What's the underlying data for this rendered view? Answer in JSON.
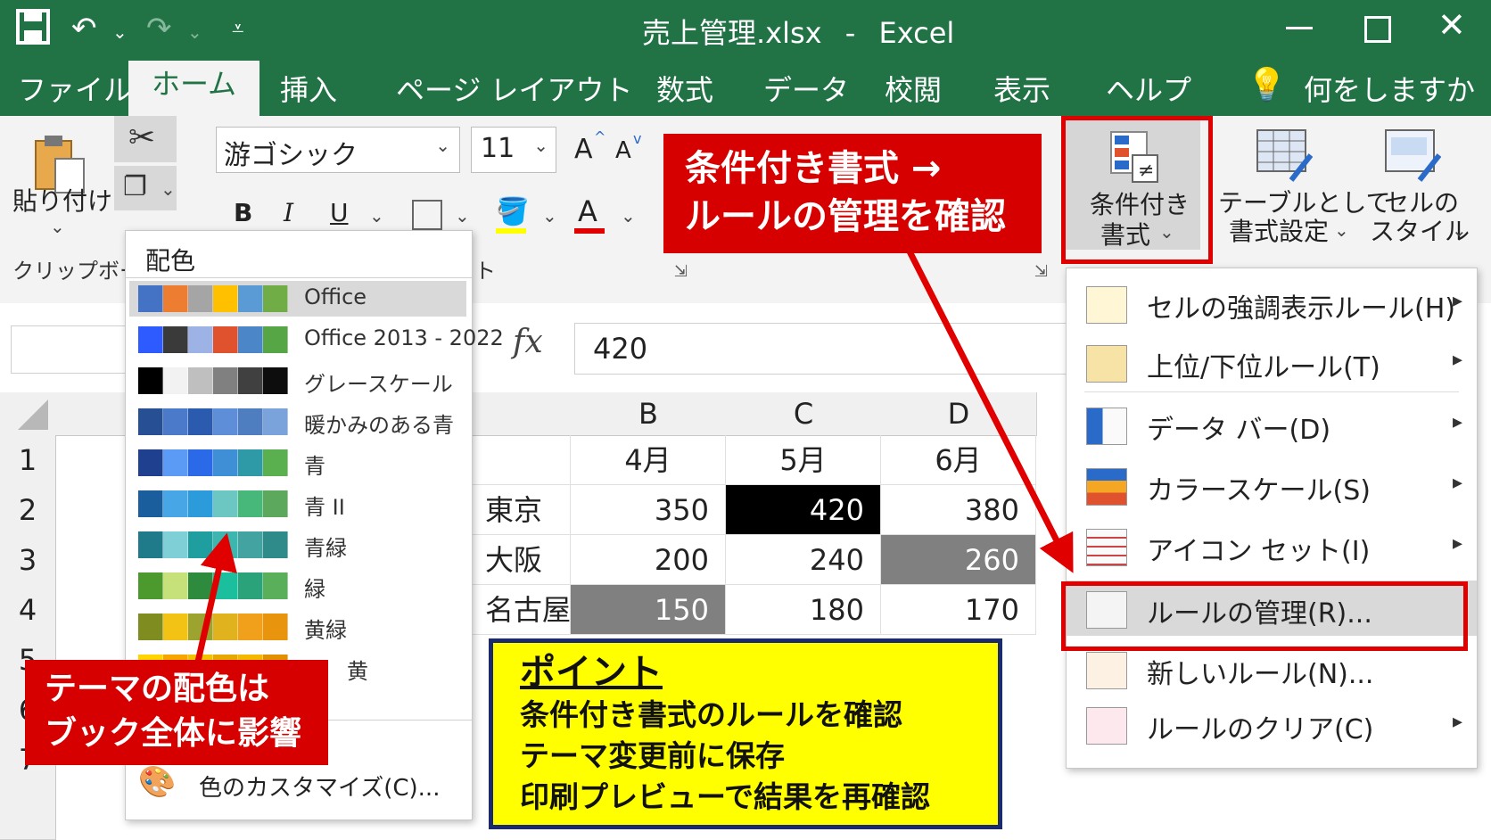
{
  "window": {
    "filename": "売上管理.xlsx",
    "separator": "-",
    "app": "Excel"
  },
  "tabs": [
    "ファイル",
    "ホーム",
    "挿入",
    "ページ レイアウト",
    "数式",
    "データ",
    "校閲",
    "表示",
    "ヘルプ"
  ],
  "active_tab": "ホーム",
  "tellme": "何をしますか",
  "ribbon": {
    "paste": "貼り付け",
    "clipboard_group": "クリップボード",
    "font_name": "游ゴシック",
    "font_size": "11",
    "bold": "B",
    "italic": "I",
    "underline": "U",
    "font_color_letter": "A",
    "grow_font": "A",
    "shrink_font": "A",
    "cond_format_line1": "条件付き",
    "cond_format_line2": "書式",
    "table_format_line1": "テーブルとして",
    "table_format_line2": "書式設定",
    "cell_style_line1": "セルの",
    "cell_style_line2": "スタイル",
    "font_group_partial": "ト"
  },
  "formula_bar": {
    "fx": "fx",
    "value": "420"
  },
  "grid": {
    "columns": [
      "B",
      "C",
      "D"
    ],
    "rows": [
      "1",
      "2",
      "3",
      "4",
      "5",
      "6",
      "7"
    ],
    "header_row": [
      "4月",
      "5月",
      "6月"
    ],
    "data": [
      {
        "city": "東京",
        "values": [
          "350",
          "420",
          "380"
        ]
      },
      {
        "city": "大阪",
        "values": [
          "200",
          "240",
          "260"
        ]
      },
      {
        "city": "名古屋",
        "values": [
          "150",
          "180",
          "170"
        ]
      }
    ]
  },
  "palette": {
    "header": "配色",
    "items": [
      {
        "name": "Office",
        "colors": [
          "#4472C4",
          "#ED7D31",
          "#A5A5A5",
          "#FFC000",
          "#5B9BD5",
          "#70AD47"
        ]
      },
      {
        "name": "Office 2013 - 2022",
        "colors": [
          "#2E5BFF",
          "#3A3A3A",
          "#9DB3E6",
          "#E0522E",
          "#4A86C8",
          "#56A646"
        ]
      },
      {
        "name": "グレースケール",
        "colors": [
          "#000000",
          "#F2F2F2",
          "#BFBFBF",
          "#808080",
          "#404040",
          "#0D0D0D"
        ]
      },
      {
        "name": "暖かみのある青",
        "colors": [
          "#264F94",
          "#4A7AC9",
          "#2A5BAE",
          "#5E8ED8",
          "#4E7DC0",
          "#7BA3DB"
        ]
      },
      {
        "name": "青",
        "colors": [
          "#1F3F8F",
          "#5B9BF5",
          "#2A6AE8",
          "#3E8FD6",
          "#2E9AA8",
          "#5AB04E"
        ]
      },
      {
        "name": "青 II",
        "colors": [
          "#1B5E9E",
          "#47A6E6",
          "#2C9BDB",
          "#6CC6C2",
          "#47B77A",
          "#5CA85C"
        ]
      },
      {
        "name": "青緑",
        "colors": [
          "#1F7B8A",
          "#7FD0D6",
          "#1E9E9E",
          "#3CB6AE",
          "#42A3A0",
          "#2F8A8A"
        ]
      },
      {
        "name": "緑",
        "colors": [
          "#4C9A2E",
          "#C6E07A",
          "#2E8B3E",
          "#1BBF9E",
          "#2BA37A",
          "#5AB05A"
        ]
      },
      {
        "name": "黄緑",
        "colors": [
          "#7F8C1F",
          "#F2C215",
          "#9CA32F",
          "#E0B21D",
          "#F0A01A",
          "#E8940C"
        ]
      },
      {
        "name": "黄",
        "colors": [
          "#FFD400",
          "#F7A600",
          "#F2C100",
          "#E6A800",
          "#F5B800",
          "#E09000"
        ]
      }
    ],
    "customize": "色のカスタマイズ(C)..."
  },
  "cf_menu": [
    {
      "label": "セルの強調表示ルール(H)",
      "submenu": true
    },
    {
      "label": "上位/下位ルール(T)",
      "submenu": true
    },
    {
      "label": "データ バー(D)",
      "submenu": true
    },
    {
      "label": "カラースケール(S)",
      "submenu": true
    },
    {
      "label": "アイコン セット(I)",
      "submenu": true
    },
    {
      "label": "ルールの管理(R)...",
      "submenu": false
    },
    {
      "label": "新しいルール(N)...",
      "submenu": false
    },
    {
      "label": "ルールのクリア(C)",
      "submenu": true
    }
  ],
  "callouts": {
    "top_line1": "条件付き書式 →",
    "top_line2": "ルールの管理を確認",
    "left_line1": "テーマの配色は",
    "left_line2": "ブック全体に影響",
    "point_title": "ポイント",
    "point_line1": "条件付き書式のルールを確認",
    "point_line2": "テーマ変更前に保存",
    "point_line3": "印刷プレビューで結果を再確認"
  },
  "colors": {
    "excel_green": "#217346",
    "callout_red": "#D70000",
    "point_yellow": "#FFFF00",
    "point_border": "#1A2A6C",
    "cell_black": "#000000",
    "cell_gray": "#808080"
  }
}
